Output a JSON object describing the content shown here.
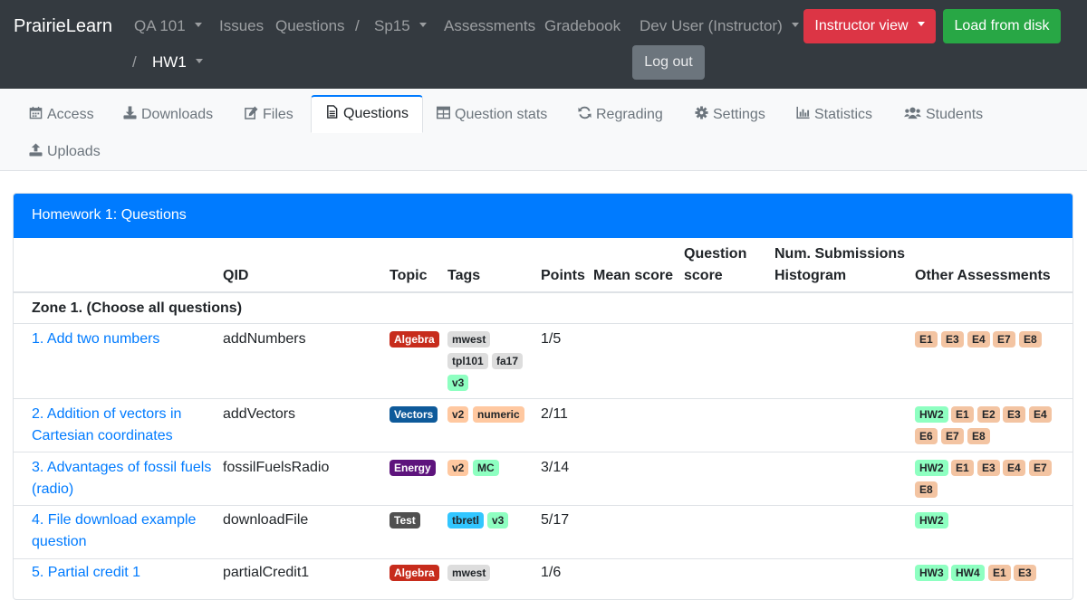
{
  "navbar": {
    "brand": "PrairieLearn",
    "course": "QA 101",
    "issues": "Issues",
    "questions": "Questions",
    "sep1": "/",
    "instance": "Sp15",
    "assessments": "Assessments",
    "gradebook": "Gradebook",
    "sep2": "/",
    "assessment": "HW1",
    "user": "Dev User (Instructor)",
    "instructor_view": "Instructor view",
    "load_from_disk": "Load from disk",
    "logout": "Log out"
  },
  "tabs": {
    "access": "Access",
    "downloads": "Downloads",
    "files": "Files",
    "questions": "Questions",
    "question_stats": "Question stats",
    "regrading": "Regrading",
    "settings": "Settings",
    "statistics": "Statistics",
    "students": "Students",
    "uploads": "Uploads"
  },
  "card": {
    "title": "Homework 1: Questions",
    "columns": {
      "qid": "QID",
      "topic": "Topic",
      "tags": "Tags",
      "points": "Points",
      "mean_score": "Mean score",
      "question_score_1": "Question",
      "question_score_2": "score",
      "histogram_1": "Num. Submissions",
      "histogram_2": "Histogram",
      "other": "Other Assessments"
    },
    "zone": "Zone 1. (Choose all questions)",
    "rows": [
      {
        "title": "1. Add two numbers",
        "qid": "addNumbers",
        "topic": "Algebra",
        "tags": [
          "mwest",
          "tpl101",
          "fa17",
          "v3"
        ],
        "points": "1/5",
        "other": [
          "E1",
          "E3",
          "E4",
          "E7",
          "E8"
        ]
      },
      {
        "title": "2. Addition of vectors in Cartesian coordinates",
        "qid": "addVectors",
        "topic": "Vectors",
        "tags": [
          "v2",
          "numeric"
        ],
        "points": "2/11",
        "other": [
          "HW2",
          "E1",
          "E2",
          "E3",
          "E4",
          "E6",
          "E7",
          "E8"
        ]
      },
      {
        "title": "3. Advantages of fossil fuels (radio)",
        "qid": "fossilFuelsRadio",
        "topic": "Energy",
        "tags": [
          "v2",
          "MC"
        ],
        "points": "3/14",
        "other": [
          "HW2",
          "E1",
          "E3",
          "E4",
          "E7",
          "E8"
        ]
      },
      {
        "title": "4. File download example question",
        "qid": "downloadFile",
        "topic": "Test",
        "tags": [
          "tbretl",
          "v3"
        ],
        "points": "5/17",
        "other": [
          "HW2"
        ]
      },
      {
        "title": "5. Partial credit 1",
        "qid": "partialCredit1",
        "topic": "Algebra",
        "tags": [
          "mwest"
        ],
        "points": "1/6",
        "other": [
          "HW3",
          "HW4",
          "E1",
          "E3"
        ]
      }
    ]
  },
  "colors": {
    "navbar": "#343a40",
    "primary": "#007bff",
    "danger": "#dc3545",
    "success": "#28a745"
  }
}
